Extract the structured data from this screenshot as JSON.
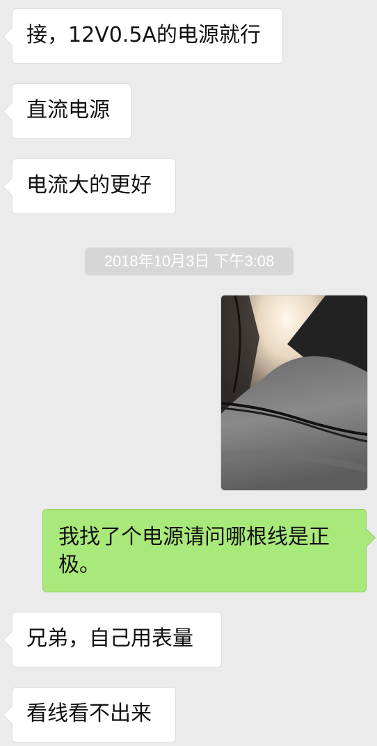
{
  "chat": {
    "messages": [
      {
        "side": "in",
        "text": "接，12V0.5A的电源就行"
      },
      {
        "side": "in",
        "text": "直流电源"
      },
      {
        "side": "in",
        "text": "电流大的更好"
      },
      {
        "side": "out",
        "text": "我找了个电源请问哪根线是正极。"
      },
      {
        "side": "in",
        "text": "兄弟，自己用表量"
      },
      {
        "side": "in",
        "text": "看线看不出来"
      }
    ],
    "timestamp": "2018年10月3日 下午3:08"
  },
  "colors": {
    "background": "#ebebeb",
    "incoming_bubble": "#ffffff",
    "outgoing_bubble": "#a9e87a",
    "timestamp_bg": "#d6d6d6"
  }
}
